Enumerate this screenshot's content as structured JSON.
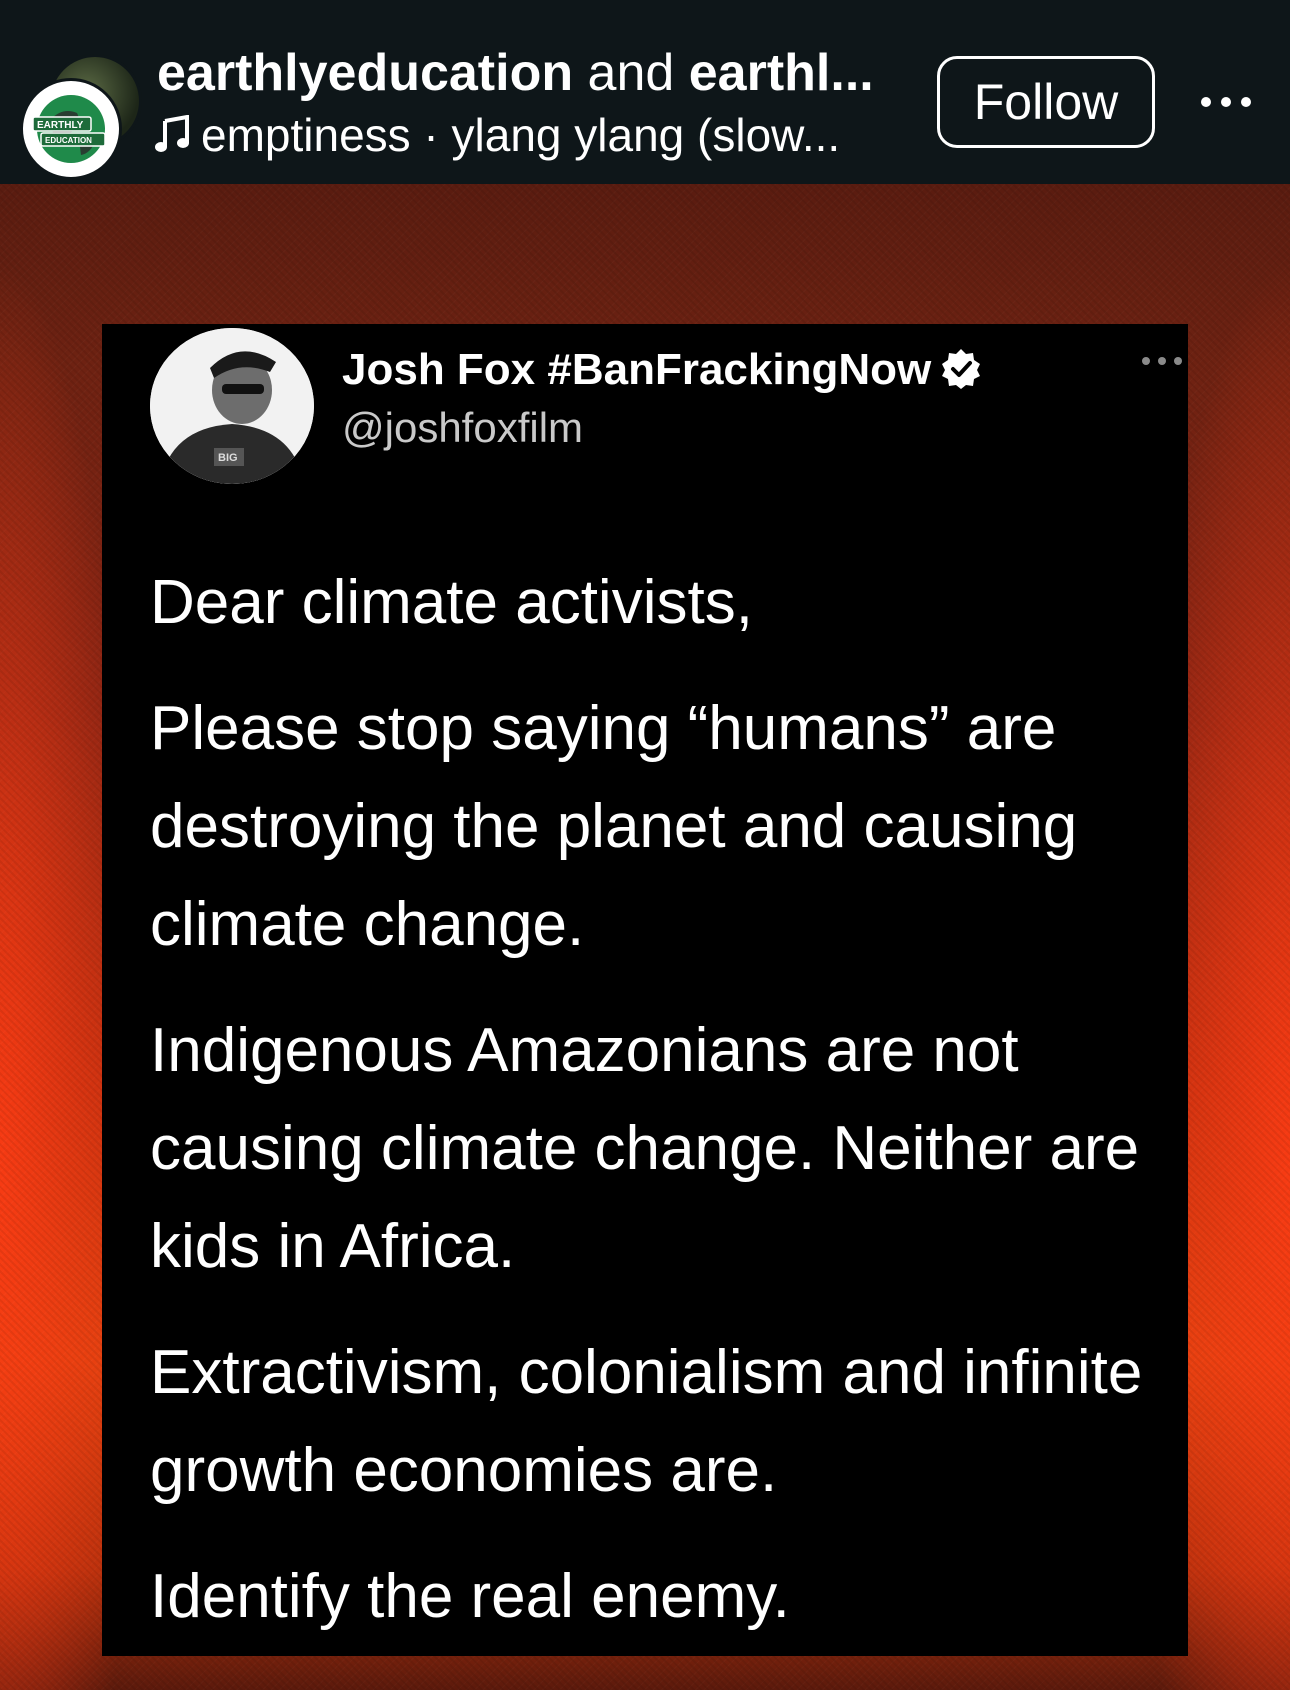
{
  "header": {
    "username_primary": "earthlyeducation",
    "connector": " and ",
    "username_secondary": "earthl...",
    "audio": "emptiness · ylang ylang (slow...",
    "follow_label": "Follow",
    "avatar_badge_top": "EARTHLY",
    "avatar_badge_bottom": "EDUCATION"
  },
  "tweet": {
    "author_name": "Josh Fox #BanFrackingNow",
    "handle": "@joshfoxfilm",
    "shirt_text": "BIG",
    "paragraphs": [
      "Dear climate activists,",
      "Please stop saying “humans” are destroying the planet and causing climate change.",
      "Indigenous Amazonians are not causing climate change. Neither are kids in Africa.",
      "Extractivism, colonialism and infinite growth economies are.",
      "Identify the real enemy."
    ]
  },
  "icons": {
    "music": "music-note-icon",
    "more": "more-horizontal-icon",
    "verified": "verified-badge-icon",
    "tweet_more": "tweet-more-icon"
  },
  "colors": {
    "header_bg": "#0e1619",
    "card_bg": "#000000",
    "accent_red": "#e0420f",
    "text": "#ffffff",
    "handle_text": "#c9c9c9"
  }
}
